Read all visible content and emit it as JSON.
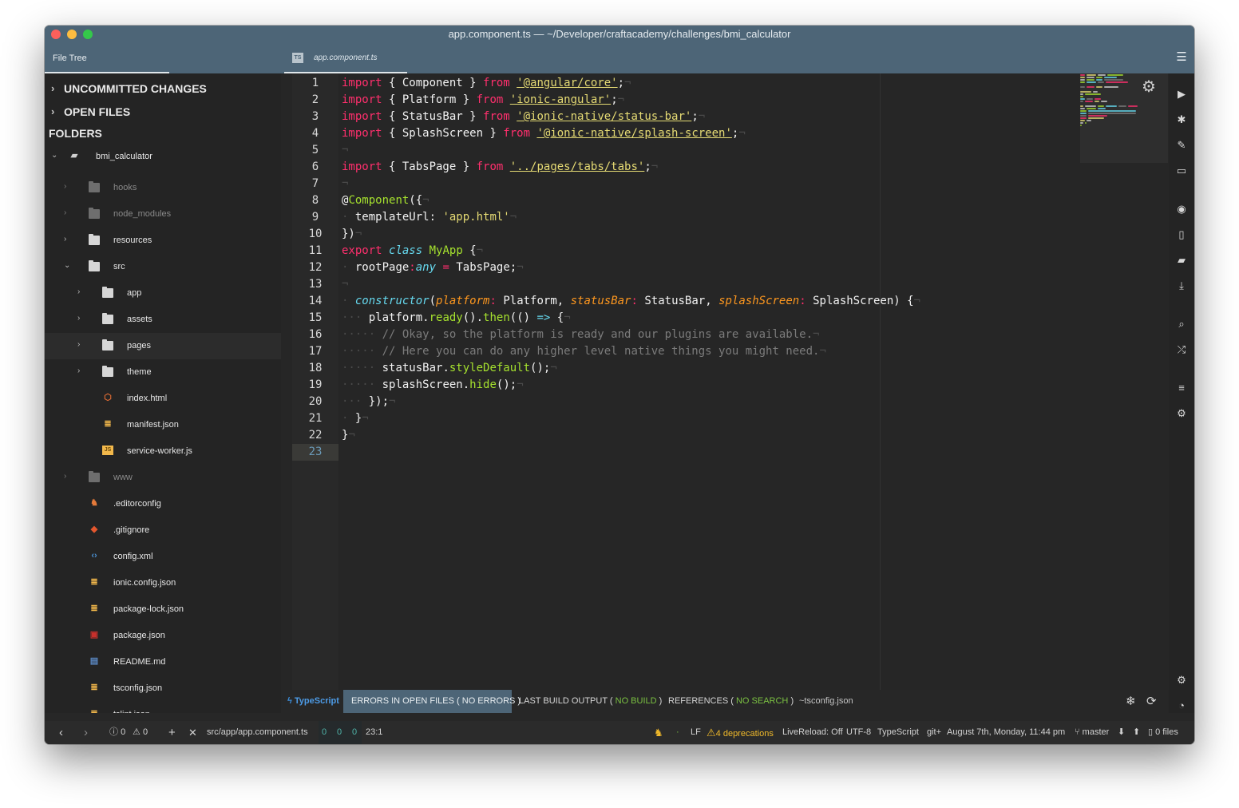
{
  "window": {
    "title": "app.component.ts — ~/Developer/craftacademy/challenges/bmi_calculator"
  },
  "sidebar": {
    "tab_label": "File Tree",
    "sections": [
      {
        "label": "UNCOMMITTED CHANGES"
      },
      {
        "label": "OPEN FILES"
      }
    ],
    "folders_label": "FOLDERS",
    "tree": [
      {
        "label": "bmi_calculator",
        "kind": "project",
        "depth": 0,
        "expanded": true,
        "dim": false
      },
      {
        "label": "hooks",
        "kind": "folder",
        "depth": 1,
        "expanded": false,
        "dim": true
      },
      {
        "label": "node_modules",
        "kind": "folder",
        "depth": 1,
        "expanded": false,
        "dim": true
      },
      {
        "label": "resources",
        "kind": "folder",
        "depth": 1,
        "expanded": false,
        "dim": false
      },
      {
        "label": "src",
        "kind": "folder",
        "depth": 1,
        "expanded": true,
        "dim": false
      },
      {
        "label": "app",
        "kind": "folder",
        "depth": 2,
        "expanded": false,
        "dim": false
      },
      {
        "label": "assets",
        "kind": "folder",
        "depth": 2,
        "expanded": false,
        "dim": false
      },
      {
        "label": "pages",
        "kind": "folder",
        "depth": 2,
        "expanded": false,
        "dim": false,
        "selected": true
      },
      {
        "label": "theme",
        "kind": "folder",
        "depth": 2,
        "expanded": false,
        "dim": false
      },
      {
        "label": "index.html",
        "kind": "html",
        "depth": 2,
        "dim": false
      },
      {
        "label": "manifest.json",
        "kind": "json",
        "depth": 2,
        "dim": false
      },
      {
        "label": "service-worker.js",
        "kind": "js",
        "depth": 2,
        "dim": false
      },
      {
        "label": "www",
        "kind": "folder",
        "depth": 1,
        "expanded": false,
        "dim": true
      },
      {
        "label": ".editorconfig",
        "kind": "editorconfig",
        "depth": 1,
        "dim": false
      },
      {
        "label": ".gitignore",
        "kind": "git",
        "depth": 1,
        "dim": false
      },
      {
        "label": "config.xml",
        "kind": "xml",
        "depth": 1,
        "dim": false
      },
      {
        "label": "ionic.config.json",
        "kind": "json",
        "depth": 1,
        "dim": false
      },
      {
        "label": "package-lock.json",
        "kind": "json",
        "depth": 1,
        "dim": false
      },
      {
        "label": "package.json",
        "kind": "npm",
        "depth": 1,
        "dim": false
      },
      {
        "label": "README.md",
        "kind": "md",
        "depth": 1,
        "dim": false
      },
      {
        "label": "tsconfig.json",
        "kind": "json",
        "depth": 1,
        "dim": false
      },
      {
        "label": "tslint.json",
        "kind": "json",
        "depth": 1,
        "dim": false
      }
    ]
  },
  "editor": {
    "tab": {
      "label": "app.component.ts",
      "badge": "TS"
    },
    "current_line": 23,
    "lines": [
      [
        [
          "k",
          "import"
        ],
        [
          "t",
          " { Component } "
        ],
        [
          "k",
          "from"
        ],
        [
          "t",
          " "
        ],
        [
          "s",
          "'@angular/core'"
        ],
        [
          "t",
          ";"
        ],
        [
          "w",
          "¬"
        ]
      ],
      [
        [
          "k",
          "import"
        ],
        [
          "t",
          " { Platform } "
        ],
        [
          "k",
          "from"
        ],
        [
          "t",
          " "
        ],
        [
          "s",
          "'ionic-angular'"
        ],
        [
          "t",
          ";"
        ],
        [
          "w",
          "¬"
        ]
      ],
      [
        [
          "k",
          "import"
        ],
        [
          "t",
          " { StatusBar } "
        ],
        [
          "k",
          "from"
        ],
        [
          "t",
          " "
        ],
        [
          "s",
          "'@ionic-native/status-bar'"
        ],
        [
          "t",
          ";"
        ],
        [
          "w",
          "¬"
        ]
      ],
      [
        [
          "k",
          "import"
        ],
        [
          "t",
          " { SplashScreen } "
        ],
        [
          "k",
          "from"
        ],
        [
          "t",
          " "
        ],
        [
          "s",
          "'@ionic-native/splash-screen'"
        ],
        [
          "t",
          ";"
        ],
        [
          "w",
          "¬"
        ]
      ],
      [
        [
          "w",
          "¬"
        ]
      ],
      [
        [
          "k",
          "import"
        ],
        [
          "t",
          " { TabsPage } "
        ],
        [
          "k",
          "from"
        ],
        [
          "t",
          " "
        ],
        [
          "s",
          "'../pages/tabs/tabs'"
        ],
        [
          "t",
          ";"
        ],
        [
          "w",
          "¬"
        ]
      ],
      [
        [
          "w",
          "¬"
        ]
      ],
      [
        [
          "t",
          "@"
        ],
        [
          "f",
          "Component"
        ],
        [
          "t",
          "({"
        ],
        [
          "w",
          "¬"
        ]
      ],
      [
        [
          "w",
          "·"
        ],
        [
          "t",
          " templateUrl: "
        ],
        [
          "sn",
          "'app.html'"
        ],
        [
          "w",
          "¬"
        ]
      ],
      [
        [
          "t",
          "})"
        ],
        [
          "w",
          "¬"
        ]
      ],
      [
        [
          "k",
          "export"
        ],
        [
          "t",
          " "
        ],
        [
          "i",
          "class"
        ],
        [
          "t",
          " "
        ],
        [
          "f",
          "MyApp"
        ],
        [
          "t",
          " {"
        ],
        [
          "w",
          "¬"
        ]
      ],
      [
        [
          "w",
          "·"
        ],
        [
          "t",
          " rootPage"
        ],
        [
          "k",
          ":"
        ],
        [
          "i",
          "any"
        ],
        [
          "t",
          " "
        ],
        [
          "k",
          "="
        ],
        [
          "t",
          " TabsPage;"
        ],
        [
          "w",
          "¬"
        ]
      ],
      [
        [
          "w",
          "¬"
        ]
      ],
      [
        [
          "w",
          "·"
        ],
        [
          "t",
          " "
        ],
        [
          "i",
          "constructor"
        ],
        [
          "t",
          "("
        ],
        [
          "p",
          "platform"
        ],
        [
          "k",
          ":"
        ],
        [
          "t",
          " Platform, "
        ],
        [
          "p",
          "statusBar"
        ],
        [
          "k",
          ":"
        ],
        [
          "t",
          " StatusBar, "
        ],
        [
          "p",
          "splashScreen"
        ],
        [
          "k",
          ":"
        ],
        [
          "t",
          " SplashScreen) {"
        ],
        [
          "w",
          "¬"
        ]
      ],
      [
        [
          "w",
          "···"
        ],
        [
          "t",
          " platform."
        ],
        [
          "f",
          "ready"
        ],
        [
          "t",
          "()."
        ],
        [
          "f",
          "then"
        ],
        [
          "t",
          "(() "
        ],
        [
          "i",
          "=>"
        ],
        [
          "t",
          " {"
        ],
        [
          "w",
          "¬"
        ]
      ],
      [
        [
          "w",
          "·····"
        ],
        [
          "c",
          " // Okay, so the platform is ready and our plugins are available."
        ],
        [
          "w",
          "¬"
        ]
      ],
      [
        [
          "w",
          "·····"
        ],
        [
          "c",
          " // Here you can do any higher level native things you might need."
        ],
        [
          "w",
          "¬"
        ]
      ],
      [
        [
          "w",
          "·····"
        ],
        [
          "t",
          " statusBar."
        ],
        [
          "f",
          "styleDefault"
        ],
        [
          "t",
          "();"
        ],
        [
          "w",
          "¬"
        ]
      ],
      [
        [
          "w",
          "·····"
        ],
        [
          "t",
          " splashScreen."
        ],
        [
          "f",
          "hide"
        ],
        [
          "t",
          "();"
        ],
        [
          "w",
          "¬"
        ]
      ],
      [
        [
          "w",
          "···"
        ],
        [
          "t",
          " });"
        ],
        [
          "w",
          "¬"
        ]
      ],
      [
        [
          "w",
          "·"
        ],
        [
          "t",
          " }"
        ],
        [
          "w",
          "¬"
        ]
      ],
      [
        [
          "t",
          "}"
        ],
        [
          "w",
          "¬"
        ]
      ],
      []
    ]
  },
  "panel": {
    "language": "TypeScript",
    "errors": "ERRORS IN OPEN FILES ( NO ERRORS )",
    "build_label": "LAST BUILD OUTPUT (",
    "build_value": "NO BUILD",
    "build_close": ")",
    "refs_label": "REFERENCES (",
    "refs_value": "NO SEARCH",
    "refs_close": ")",
    "tsconfig": "~tsconfig.json"
  },
  "status": {
    "errors_count": "0",
    "warnings_count": "0",
    "path": "src/app/app.component.ts",
    "counts": [
      "0",
      "0",
      "0"
    ],
    "cursor": "23:1",
    "line_ending": "LF",
    "deprecations": "4 deprecations",
    "livereload": "LiveReload: Off",
    "encoding": "UTF-8",
    "grammar": "TypeScript",
    "git_label": "git+",
    "datetime": "August 7th, Monday, 11:44 pm",
    "branch": "master",
    "files": "0 files"
  },
  "colors": {
    "header": "#4d6577",
    "editor_bg": "#262626",
    "keyword": "#ff2f6d",
    "string": "#e6db74",
    "function": "#a6e22e",
    "storage": "#66d9ef",
    "param": "#fd971f",
    "success": "#7bc142",
    "warning": "#f0b92a"
  }
}
